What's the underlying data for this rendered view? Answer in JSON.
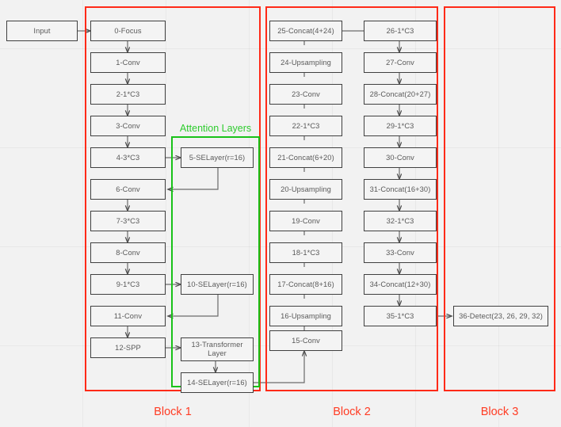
{
  "diagram": {
    "title": "Network architecture block diagram",
    "background_color": "#f2f2f2",
    "node_border_color": "#404040",
    "node_text_color": "#595959",
    "block_color": "#ff2a18",
    "attention_color": "#19c219"
  },
  "input": {
    "label": "Input"
  },
  "groups": {
    "block1": {
      "label": "Block 1"
    },
    "block2": {
      "label": "Block 2"
    },
    "block3": {
      "label": "Block 3"
    },
    "attention": {
      "label": "Attention Layers"
    }
  },
  "nodes": {
    "backbone": [
      {
        "id": "n0",
        "label": "0-Focus"
      },
      {
        "id": "n1",
        "label": "1-Conv"
      },
      {
        "id": "n2",
        "label": "2-1*C3"
      },
      {
        "id": "n3",
        "label": "3-Conv"
      },
      {
        "id": "n4",
        "label": "4-3*C3"
      },
      {
        "id": "n6",
        "label": "6-Conv"
      },
      {
        "id": "n7",
        "label": "7-3*C3"
      },
      {
        "id": "n8",
        "label": "8-Conv"
      },
      {
        "id": "n9",
        "label": "9-1*C3"
      },
      {
        "id": "n11",
        "label": "11-Conv"
      },
      {
        "id": "n12",
        "label": "12-SPP"
      }
    ],
    "attention": [
      {
        "id": "n5",
        "label": "5-SELayer(r=16)"
      },
      {
        "id": "n10",
        "label": "10-SELayer(r=16)"
      },
      {
        "id": "n13",
        "label": "13-Transformer\nLayer"
      },
      {
        "id": "n14",
        "label": "14-SELayer(r=16)"
      }
    ],
    "neck_left": [
      {
        "id": "n15",
        "label": "15-Conv"
      },
      {
        "id": "n16",
        "label": "16-Upsampling"
      },
      {
        "id": "n17",
        "label": "17-Concat(8+16)"
      },
      {
        "id": "n18",
        "label": "18-1*C3"
      },
      {
        "id": "n19",
        "label": "19-Conv"
      },
      {
        "id": "n20",
        "label": "20-Upsampling"
      },
      {
        "id": "n21",
        "label": "21-Concat(6+20)"
      },
      {
        "id": "n22",
        "label": "22-1*C3"
      },
      {
        "id": "n23",
        "label": "23-Conv"
      },
      {
        "id": "n24",
        "label": "24-Upsampling"
      },
      {
        "id": "n25",
        "label": "25-Concat(4+24)"
      }
    ],
    "neck_right": [
      {
        "id": "n26",
        "label": "26-1*C3"
      },
      {
        "id": "n27",
        "label": "27-Conv"
      },
      {
        "id": "n28",
        "label": "28-Concat(20+27)"
      },
      {
        "id": "n29",
        "label": "29-1*C3"
      },
      {
        "id": "n30",
        "label": "30-Conv"
      },
      {
        "id": "n31",
        "label": "31-Concat(16+30)"
      },
      {
        "id": "n32",
        "label": "32-1*C3"
      },
      {
        "id": "n33",
        "label": "33-Conv"
      },
      {
        "id": "n34",
        "label": "34-Concat(12+30)"
      },
      {
        "id": "n35",
        "label": "35-1*C3"
      }
    ],
    "head": [
      {
        "id": "n36",
        "label": "36-Detect(23, 26, 29, 32)"
      }
    ]
  }
}
